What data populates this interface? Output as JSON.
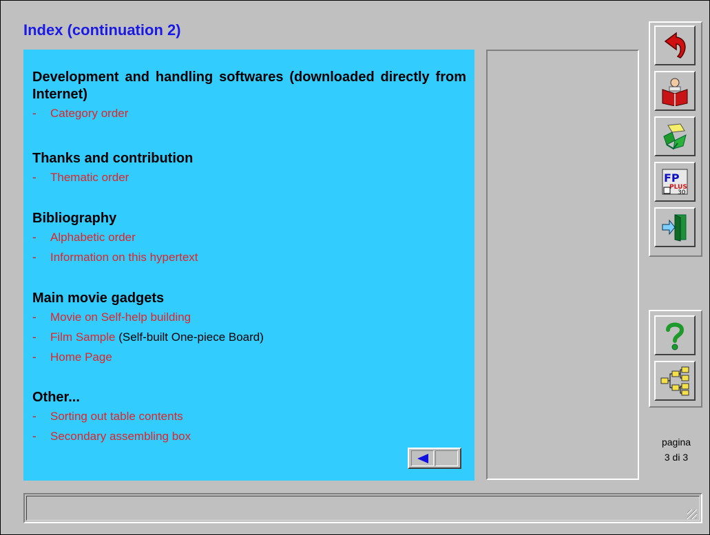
{
  "page": {
    "title": "Index (continuation 2)"
  },
  "sections": [
    {
      "title": "Development and handling softwares (downloaded directly from Internet)",
      "items": [
        {
          "dash": "-",
          "link": "Category order",
          "suffix": ""
        }
      ]
    },
    {
      "title": "Thanks and contribution",
      "items": [
        {
          "dash": "-",
          "link": "Thematic order",
          "suffix": ""
        }
      ]
    },
    {
      "title": "Bibliography",
      "items": [
        {
          "dash": "-",
          "link": "Alphabetic order",
          "suffix": ""
        },
        {
          "dash": "-",
          "link": "Information on this hypertext",
          "suffix": ""
        }
      ]
    },
    {
      "title": "Main movie gadgets",
      "items": [
        {
          "dash": "-",
          "link": "Movie on Self-help building",
          "suffix": ""
        },
        {
          "dash": "-",
          "link": "Film Sample",
          "suffix": " (Self-built One-piece Board)"
        },
        {
          "dash": "-",
          "link": "Home Page",
          "suffix": ""
        }
      ]
    },
    {
      "title": "Other...",
      "items": [
        {
          "dash": "-",
          "link": "Sorting out table contents",
          "suffix": ""
        },
        {
          "dash": "-",
          "link": "Secondary assembling box",
          "suffix": ""
        }
      ]
    }
  ],
  "toolbar": {
    "top_buttons": [
      {
        "icon": "back-arrow-icon"
      },
      {
        "icon": "reading-book-icon"
      },
      {
        "icon": "recycle-box-icon"
      },
      {
        "icon": "fp-plus-app-icon"
      },
      {
        "icon": "exit-door-icon"
      }
    ],
    "bottom_buttons": [
      {
        "icon": "help-question-icon"
      },
      {
        "icon": "sitemap-tree-icon"
      }
    ]
  },
  "pagination": {
    "label": "pagina",
    "position": "3 di 3"
  },
  "colors": {
    "panel": "#33ccff",
    "title": "#1a1ae6",
    "link": "#e02525",
    "chrome": "#c0c0c0"
  },
  "status_bar": {
    "text": ""
  }
}
